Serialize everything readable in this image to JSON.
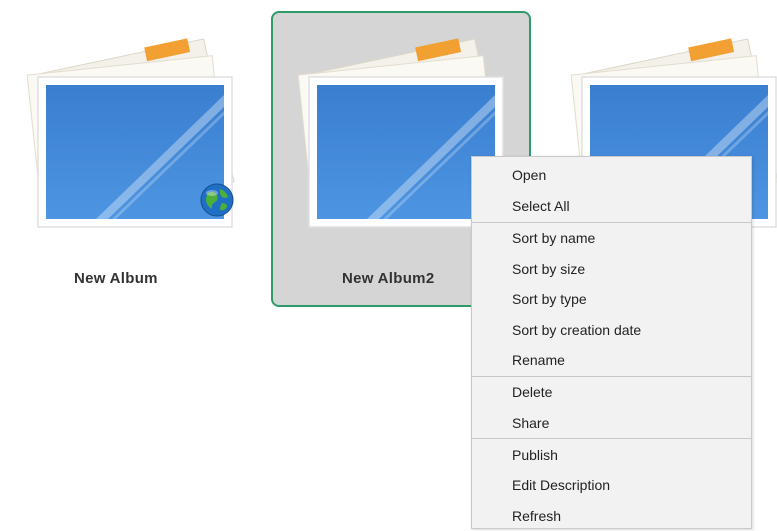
{
  "albums": [
    {
      "label": "New Album",
      "shared": true,
      "selected": false
    },
    {
      "label": "New Album2",
      "shared": false,
      "selected": true
    },
    {
      "label": "",
      "shared": false,
      "selected": false
    }
  ],
  "context_menu": {
    "items": [
      {
        "label": "Open"
      },
      {
        "label": "Select All"
      },
      {
        "label": "Sort by name"
      },
      {
        "label": "Sort by size"
      },
      {
        "label": "Sort by type"
      },
      {
        "label": "Sort by creation date"
      },
      {
        "label": "Rename"
      },
      {
        "label": "Delete"
      },
      {
        "label": "Share"
      },
      {
        "label": "Publish"
      },
      {
        "label": "Edit Description"
      },
      {
        "label": "Refresh"
      }
    ]
  },
  "icons": {
    "album": "photo-stack-icon",
    "shared_badge": "globe-icon"
  },
  "colors": {
    "selection_border": "#2f9a6a",
    "selection_bg": "#d5d5d5",
    "photo_blue": "#3f86d6",
    "accent_orange": "#f2a031",
    "menu_bg": "#f2f2f2"
  }
}
